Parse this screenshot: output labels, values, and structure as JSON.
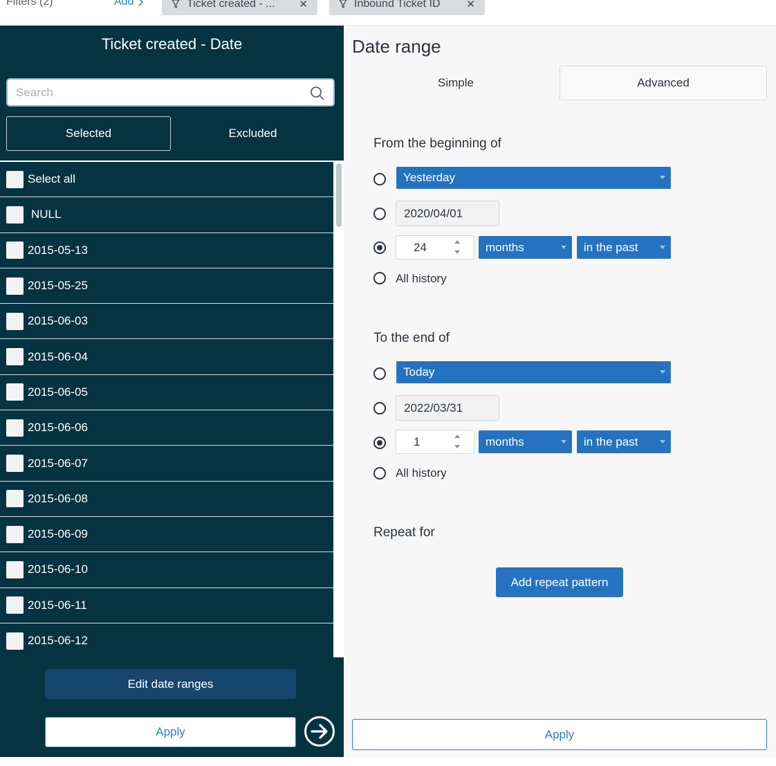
{
  "topbar": {
    "filters_label": "Filters (2)",
    "add_label": "Add",
    "chips": [
      {
        "label": "Ticket created - ..."
      },
      {
        "label": "Inbound Ticket ID"
      }
    ]
  },
  "left_panel": {
    "title": "Ticket created - Date",
    "search_placeholder": "Search",
    "selected_label": "Selected",
    "excluded_label": "Excluded",
    "items": [
      "Select all",
      "NULL",
      "2015-05-13",
      "2015-05-25",
      "2015-06-03",
      "2015-06-04",
      "2015-06-05",
      "2015-06-06",
      "2015-06-07",
      "2015-06-08",
      "2015-06-09",
      "2015-06-10",
      "2015-06-11",
      "2015-06-12"
    ],
    "edit_label": "Edit date ranges",
    "apply_label": "Apply"
  },
  "right_panel": {
    "title": "Date range",
    "tab_simple": "Simple",
    "tab_advanced": "Advanced",
    "from": {
      "label": "From the beginning of",
      "preset": "Yesterday",
      "date": "2020/04/01",
      "amount": "24",
      "unit": "months",
      "direction": "in the past",
      "all_history": "All history",
      "selected_option": "relative"
    },
    "to": {
      "label": "To the end of",
      "preset": "Today",
      "date": "2022/03/31",
      "amount": "1",
      "unit": "months",
      "direction": "in the past",
      "all_history": "All history",
      "selected_option": "relative"
    },
    "repeat_label": "Repeat for",
    "repeat_button": "Add repeat pattern",
    "apply_label": "Apply"
  },
  "colors": {
    "panel_dark": "#063341",
    "accent_blue": "#2573c0",
    "link_blue": "#2f7cc4",
    "edit_button": "#16466e"
  }
}
